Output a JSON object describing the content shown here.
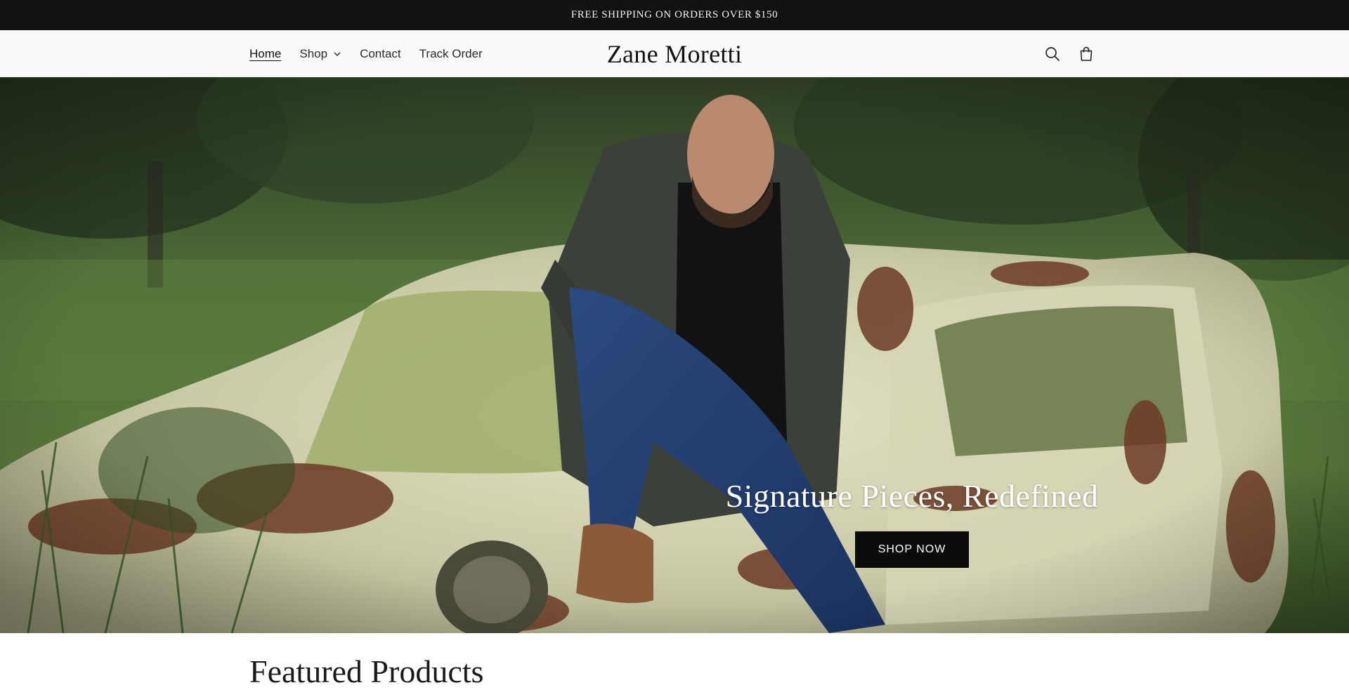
{
  "announcement": {
    "text": "FREE SHIPPING ON ORDERS OVER $150"
  },
  "header": {
    "nav": [
      {
        "label": "Home",
        "active": true
      },
      {
        "label": "Shop",
        "has_dropdown": true
      },
      {
        "label": "Contact"
      },
      {
        "label": "Track Order"
      }
    ],
    "brand": "Zane Moretti",
    "icons": [
      "search-icon",
      "cart-icon"
    ]
  },
  "hero": {
    "title": "Signature Pieces, Redefined",
    "button_label": "SHOP NOW"
  },
  "featured": {
    "title": "Featured Products"
  },
  "colors": {
    "announcement_bg": "#121212",
    "header_bg": "#faf9f9",
    "button_bg": "#0b0b0b",
    "text_dark": "#121212"
  }
}
